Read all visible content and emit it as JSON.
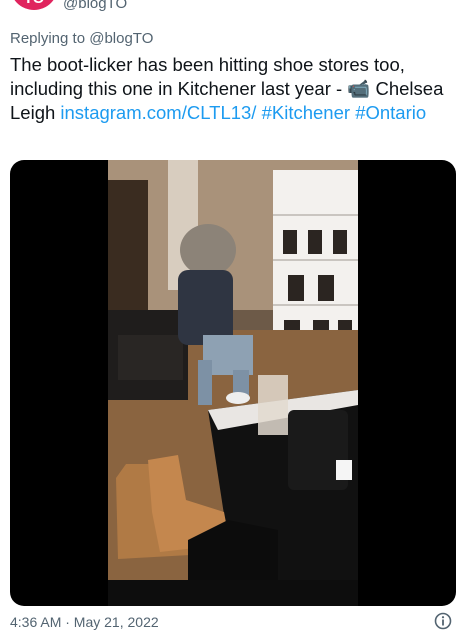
{
  "author": {
    "avatar_text": "TO",
    "handle": "@blogTO"
  },
  "reply": {
    "prefix": "Replying to",
    "mention": "@blogTO"
  },
  "tweet": {
    "text_main": "The boot-licker has been hitting shoe stores too, including this one in Kitchener last year - ",
    "camera_emoji": "📹",
    "text_credit": " Chelsea Leigh ",
    "link": "instagram.com/CLTL13/",
    "hashtag_1": "#Kitchener",
    "hashtag_2": "#Ontario"
  },
  "footer": {
    "timestamp": "4:36 AM · May 21, 2022"
  },
  "icons": {
    "info": "info-icon",
    "camera": "video-camera-icon"
  },
  "colors": {
    "link": "#1d9bf0",
    "secondary_text": "#536471",
    "avatar_bg": "#e0245e"
  }
}
